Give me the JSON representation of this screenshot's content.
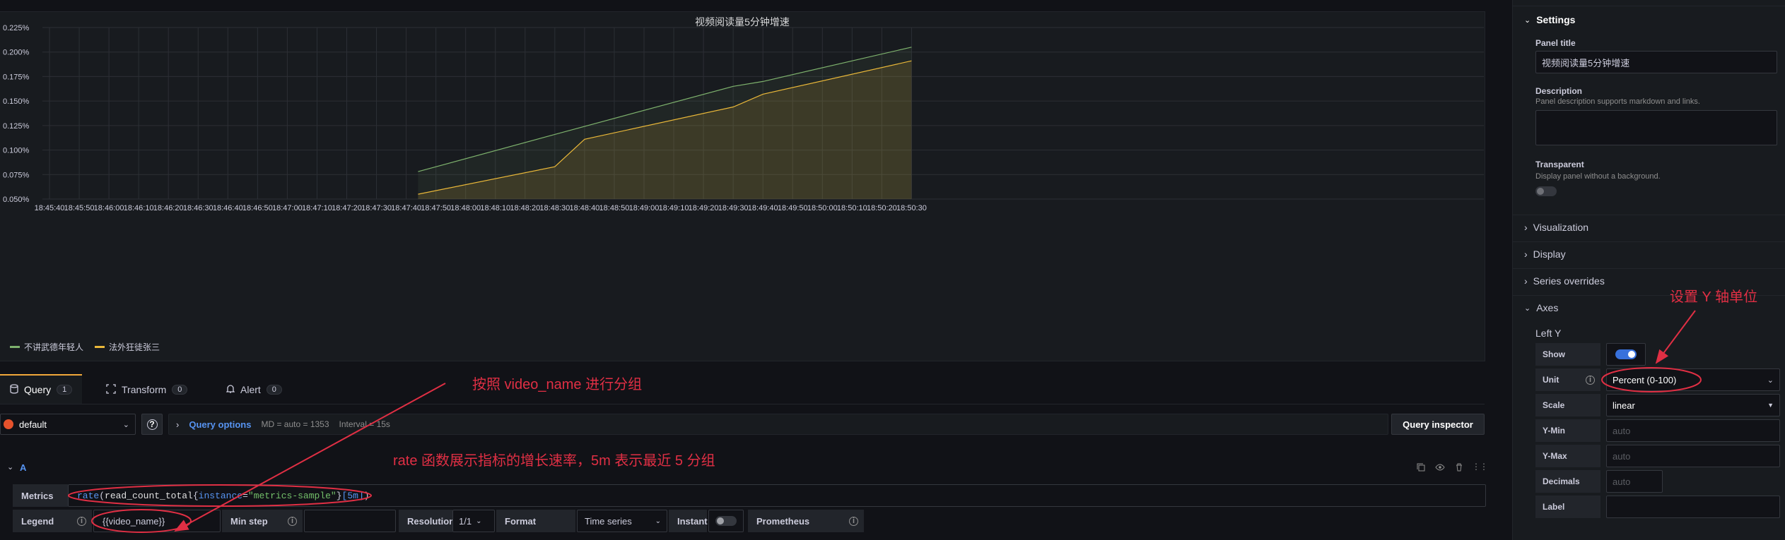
{
  "panel": {
    "title": "视频阅读量5分钟增速"
  },
  "chart_data": {
    "type": "area",
    "title": "视频阅读量5分钟增速",
    "y_ticks": [
      "0.225%",
      "0.200%",
      "0.175%",
      "0.150%",
      "0.125%",
      "0.100%",
      "0.075%",
      "0.050%"
    ],
    "ylim": [
      0.05,
      0.225
    ],
    "y_unit": "%",
    "x_ticks": [
      "18:45:40",
      "18:45:50",
      "18:46:00",
      "18:46:10",
      "18:46:20",
      "18:46:30",
      "18:46:40",
      "18:46:50",
      "18:47:00",
      "18:47:10",
      "18:47:20",
      "18:47:30",
      "18:47:40",
      "18:47:50",
      "18:48:00",
      "18:48:10",
      "18:48:20",
      "18:48:30",
      "18:48:40",
      "18:48:50",
      "18:49:00",
      "18:49:10",
      "18:49:20",
      "18:49:30",
      "18:49:40",
      "18:49:50",
      "18:50:00",
      "18:50:10",
      "18:50:20",
      "18:50:30"
    ],
    "grid": true,
    "legend_position": "bottom-left",
    "series": [
      {
        "name": "不讲武德年轻人",
        "color": "#7eb26d",
        "points": [
          {
            "x": "18:47:44",
            "y": 0.078
          },
          {
            "x": "18:48:30",
            "y": 0.116
          },
          {
            "x": "18:49:30",
            "y": 0.165
          },
          {
            "x": "18:49:40",
            "y": 0.17
          },
          {
            "x": "18:50:30",
            "y": 0.205
          }
        ]
      },
      {
        "name": "法外狂徒张三",
        "color": "#eab839",
        "points": [
          {
            "x": "18:47:44",
            "y": 0.055
          },
          {
            "x": "18:48:30",
            "y": 0.083
          },
          {
            "x": "18:48:40",
            "y": 0.111
          },
          {
            "x": "18:49:30",
            "y": 0.144
          },
          {
            "x": "18:49:40",
            "y": 0.157
          },
          {
            "x": "18:50:30",
            "y": 0.191
          }
        ]
      }
    ]
  },
  "tabs": [
    {
      "label": "Query",
      "count": "1"
    },
    {
      "label": "Transform",
      "count": "0"
    },
    {
      "label": "Alert",
      "count": "0"
    }
  ],
  "query_bar": {
    "datasource": "default",
    "query_options_label": "Query options",
    "md_text": "MD = auto = 1353",
    "interval_text": "Interval = 15s",
    "inspector_label": "Query inspector"
  },
  "query": {
    "ref_id": "A",
    "metrics_label": "Metrics",
    "expr_func": "rate",
    "expr_metric": "read_count_total",
    "expr_label_key": "instance",
    "expr_label_val": "\"metrics-sample\"",
    "expr_range": "[5m]",
    "legend_label": "Legend",
    "legend_value": "{{video_name}}",
    "min_step_label": "Min step",
    "min_step_value": "",
    "resolution_label": "Resolution",
    "resolution_value": "1/1",
    "format_label": "Format",
    "format_value": "Time series",
    "instant_label": "Instant",
    "instant_on": false,
    "prometheus_label": "Prometheus"
  },
  "annotations": {
    "group": "按照 video_name 进行分组",
    "rate": "rate 函数展示指标的增长速率，5m 表示最近 5 分组",
    "y_unit": "设置 Y 轴单位"
  },
  "settings": {
    "header": "Settings",
    "panel_title_label": "Panel title",
    "panel_title_value": "视频阅读量5分钟增速",
    "description_label": "Description",
    "description_hint": "Panel description supports markdown and links.",
    "transparent_label": "Transparent",
    "transparent_hint": "Display panel without a background.",
    "transparent_on": false,
    "sections": [
      "Visualization",
      "Display",
      "Series overrides"
    ],
    "axes_label": "Axes",
    "left_y_label": "Left Y",
    "show_label": "Show",
    "show_on": true,
    "unit_label": "Unit",
    "unit_value": "Percent (0-100)",
    "scale_label": "Scale",
    "scale_value": "linear",
    "ymin_label": "Y-Min",
    "ymin_placeholder": "auto",
    "ymax_label": "Y-Max",
    "ymax_placeholder": "auto",
    "decimals_label": "Decimals",
    "decimals_placeholder": "auto",
    "label_label": "Label"
  },
  "colors": {
    "accent_blue": "#3871dc",
    "annotation_red": "#e02f44",
    "tab_orange": "#f2a83a"
  }
}
